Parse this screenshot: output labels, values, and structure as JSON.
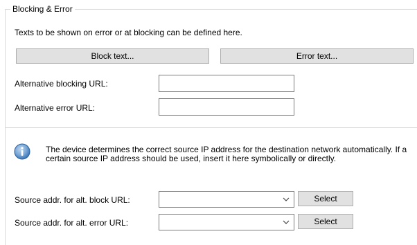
{
  "group": {
    "title": "Blocking & Error",
    "description": "Texts to be shown on error or at blocking can be defined here."
  },
  "buttons": {
    "block_text": "Block text...",
    "error_text": "Error text...",
    "select_block": "Select",
    "select_error": "Select"
  },
  "fields": {
    "alt_blocking_url_label": "Alternative blocking URL:",
    "alt_blocking_url_value": "",
    "alt_error_url_label": "Alternative error URL:",
    "alt_error_url_value": ""
  },
  "info": {
    "icon": "info-icon",
    "text": "The device determines the correct source IP address for the destination network automatically. If a certain source IP address should be used, insert it here symbolically or directly."
  },
  "source": {
    "block_label": "Source addr. for alt. block URL:",
    "block_value": "",
    "error_label": "Source addr. for alt. error URL:",
    "error_value": ""
  },
  "colors": {
    "button_bg": "#e1e1e1",
    "button_border": "#adadad",
    "input_border": "#7a7a7a",
    "info_icon": "#2f6fb4"
  }
}
